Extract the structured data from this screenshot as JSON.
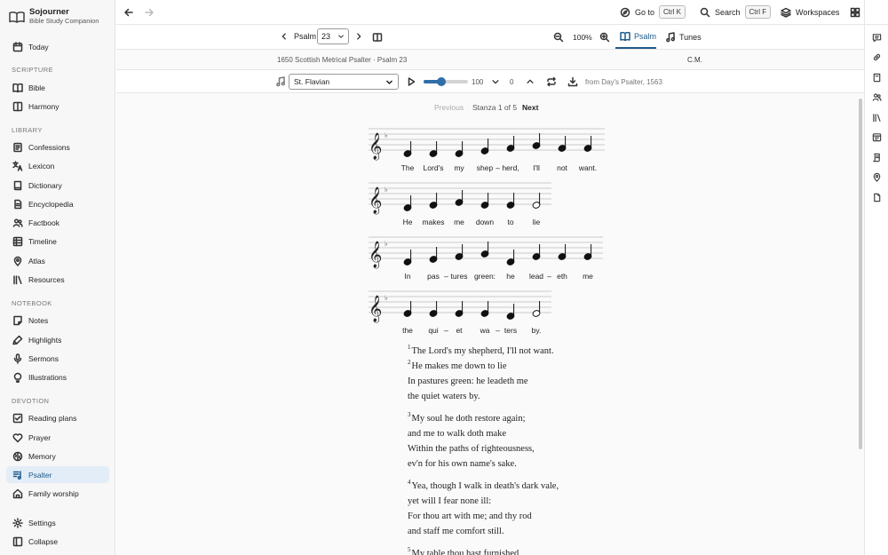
{
  "app": {
    "name": "Sojourner",
    "subtitle": "Bible Study Companion"
  },
  "sidebar": {
    "today": "Today",
    "sections": {
      "scripture": "SCRIPTURE",
      "library": "LIBRARY",
      "notebook": "NOTEBOOK",
      "devotion": "DEVOTION"
    },
    "scripture_items": [
      "Bible",
      "Harmony"
    ],
    "library_items": [
      "Confessions",
      "Lexicon",
      "Dictionary",
      "Encyclopedia",
      "Factbook",
      "Timeline",
      "Atlas",
      "Resources"
    ],
    "notebook_items": [
      "Notes",
      "Highlights",
      "Sermons",
      "Illustrations"
    ],
    "devotion_items": [
      "Reading plans",
      "Prayer",
      "Memory",
      "Psalter",
      "Family worship"
    ],
    "active_item": "Psalter",
    "settings": "Settings",
    "collapse": "Collapse"
  },
  "topbar": {
    "goto_label": "Go to",
    "goto_shortcut": "Ctrl K",
    "search_label": "Search",
    "search_shortcut": "Ctrl F",
    "workspaces_label": "Workspaces"
  },
  "toolbar": {
    "book_label": "Psalm",
    "chapter_value": "23",
    "zoom": "100%",
    "tabs": [
      "Psalm",
      "Tunes"
    ],
    "active_tab": "Psalm"
  },
  "info": {
    "source": "1650 Scottish Metrical Psalter · Psalm 23",
    "meter": "C.M."
  },
  "player": {
    "tune": "St. Flavian",
    "tempo": "100",
    "tempo_fraction": 0.4,
    "transpose": "0",
    "tune_source": "from Day's Psalter, 1563"
  },
  "stanza": {
    "previous": "Previous",
    "label": "Stanza 1 of 5",
    "next": "Next"
  },
  "music": {
    "lines": [
      {
        "syllables": [
          "The",
          "Lord's",
          "my",
          "shep",
          "herd,",
          "I'll",
          "not",
          "want."
        ],
        "hyphens_after": [
          3
        ]
      },
      {
        "syllables": [
          "He",
          "makes",
          "me",
          "down",
          "to",
          "lie"
        ],
        "hyphens_after": []
      },
      {
        "syllables": [
          "In",
          "pas",
          "tures",
          "green:",
          "he",
          "lead",
          "eth",
          "me"
        ],
        "hyphens_after": [
          1,
          5
        ]
      },
      {
        "syllables": [
          "the",
          "qui",
          "et",
          "wa",
          "ters",
          "by."
        ],
        "hyphens_after": [
          1,
          3
        ]
      }
    ],
    "hyphen": "–"
  },
  "verses": [
    {
      "num": "1",
      "lines": [
        "The Lord's my shepherd, I'll not want.",
        "He makes me down to lie",
        "In pastures green: he leadeth me",
        "the quiet waters by."
      ],
      "num2": "2"
    },
    {
      "num": "3",
      "lines": [
        "My soul he doth restore again;",
        "and me to walk doth make",
        "Within the paths of righteousness,",
        "ev'n for his own name's sake."
      ]
    },
    {
      "num": "4",
      "lines": [
        "Yea, though I walk in death's dark vale,",
        "yet will I fear none ill:",
        "For thou art with me; and thy rod",
        "and staff me comfort still."
      ]
    },
    {
      "num": "5",
      "lines": [
        "My table thou hast furnished"
      ]
    }
  ]
}
